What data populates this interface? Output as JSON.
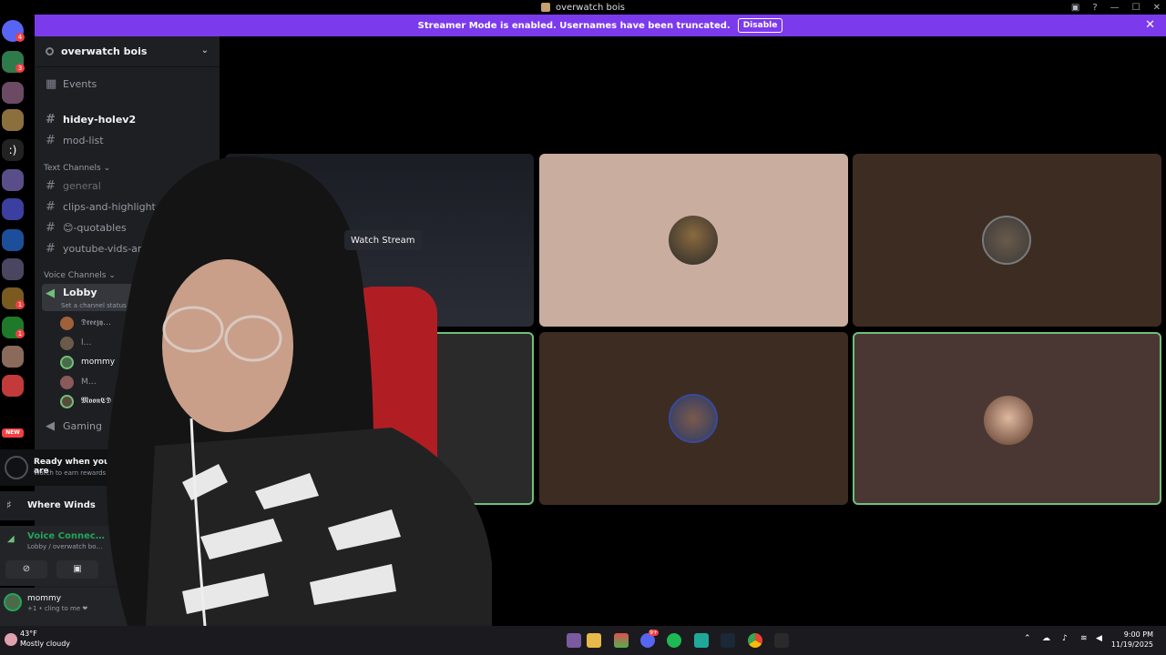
{
  "window": {
    "title": "overwatch bois",
    "controls": [
      "inbox-icon",
      "help-icon",
      "minimize",
      "maximize",
      "close"
    ]
  },
  "banner": {
    "text": "Streamer Mode is enabled. Usernames have been truncated.",
    "button": "Disable"
  },
  "servers": {
    "badges": [
      "4",
      "3",
      "1",
      "1"
    ],
    "new_label": "NEW"
  },
  "sidebar": {
    "server_name": "overwatch bois",
    "events": "Events",
    "channels_top": [
      "hidey-holev2",
      "mod-list"
    ],
    "text_category": "Text Channels",
    "text_channels": [
      "general",
      "clips-and-highlight",
      "😊-quotables",
      "youtube-vids-and"
    ],
    "voice_category": "Voice Channels",
    "lobby": "Lobby",
    "lobby_status": "Set a channel status",
    "voice_users": [
      "𝕯𝖗𝖊𝖊𝖟𝖞…",
      "l…",
      "mommy",
      "M…",
      "𝕸𝖔𝖔𝖓𝕮𝕯"
    ],
    "gaming": "Gaming",
    "ready_title": "Ready when you are",
    "ready_sub": "Watch to earn rewards",
    "where_winds": "Where Winds",
    "voice_connected": "Voice Connec…",
    "voice_location": "Lobby / overwatch bo…",
    "user_name": "mommy",
    "user_status": "+1 • cling to me ❤"
  },
  "stage": {
    "watch_stream": "Watch Stream"
  },
  "taskbar": {
    "temperature": "43°F",
    "condition": "Mostly cloudy",
    "time": "9:00 PM",
    "date": "11/19/2025",
    "badge_count": "9+"
  },
  "colors": {
    "banner": "#7c3aed",
    "speaking": "#6ec07a",
    "tile_beige": "#c9ad9f",
    "tile_brown": "#3d2c22",
    "tile_dark_brown": "#4a3733"
  }
}
